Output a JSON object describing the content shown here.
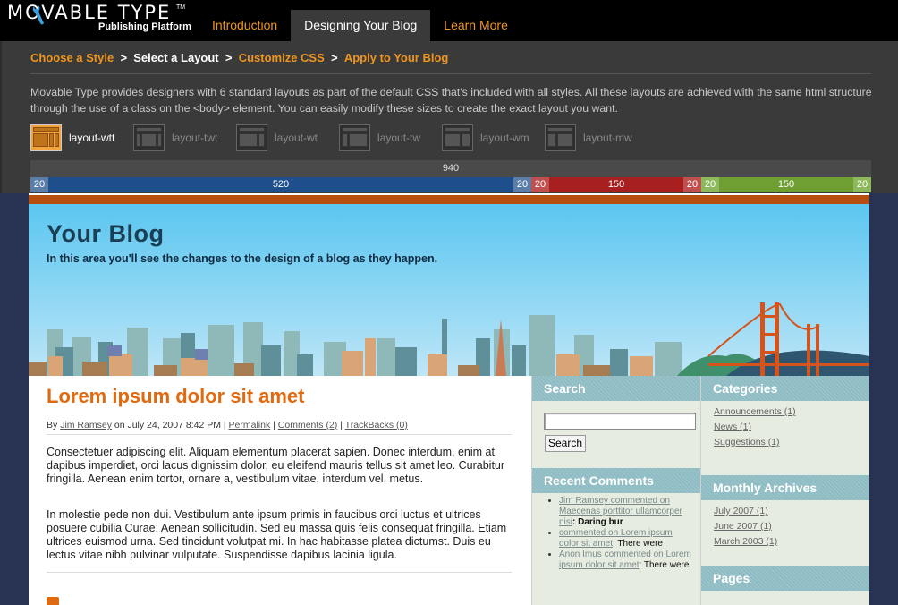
{
  "logo": {
    "word": "MOVABLE TYPE",
    "tm": "TM",
    "sub": "Publishing Platform"
  },
  "tabs": [
    "Introduction",
    "Designing Your Blog",
    "Learn More"
  ],
  "breadcrumbs": [
    "Choose a Style",
    "Select a Layout",
    "Customize CSS",
    "Apply to Your Blog"
  ],
  "breadcrumb_sep": ">",
  "description": "Movable Type provides designers with 6 standard layouts as part of the default CSS that's included with all styles. All these layouts are achieved with the same html structure through the use of a class on the <body> element. You can easily modify these sizes to create the exact layout you want.",
  "layouts": [
    "layout-wtt",
    "layout-twt",
    "layout-wt",
    "layout-tw",
    "layout-wm",
    "layout-mw"
  ],
  "selected_layout": "layout-wtt",
  "ruler": {
    "total": "940",
    "segments": [
      "20",
      "520",
      "20",
      "20",
      "150",
      "20",
      "20",
      "150",
      "20"
    ]
  },
  "colors": {
    "accent": "#f0951e",
    "blue": "#1e4f8c",
    "red": "#a81f1f",
    "green": "#6f9e33",
    "title": "#e06a10"
  },
  "blog": {
    "title": "Your Blog",
    "description": "In this area you'll see the changes to the design of a blog as they happen."
  },
  "post": {
    "title": "Lorem ipsum dolor sit amet",
    "by": "By",
    "author": "Jim Ramsey",
    "date": "on July 24, 2007 8:42 PM |",
    "permalink": "Permalink",
    "comments": "Comments (2)",
    "trackbacks": "TrackBacks (0)",
    "para1": "Consectetuer adipiscing elit. Aliquam elementum placerat sapien. Donec interdum, enim at dapibus imperdiet, orci lacus dignissim dolor, eu eleifend mauris tellus sit amet leo. Curabitur fringilla. Aenean enim tortor, ornare a, vestibulum vitae, interdum vel, metus.",
    "para2": "In molestie pede non dui. Vestibulum ante ipsum primis in faucibus orci luctus et ultrices posuere cubilia Curae; Aenean sollicitudin. Sed eu massa quis felis consequat fringilla. Etiam ultrices euismod urna. Sed tincidunt volutpat mi. In hac habitasse platea dictumst. Duis eu lectus vitae nibh pulvinar vulputate. Suspendisse dapibus lacinia ligula."
  },
  "sidebar_mid": {
    "search_title": "Search",
    "search_button": "Search",
    "recent_title": "Recent Comments",
    "recent": [
      {
        "link": "Jim Ramsey commented on Maecenas porttitor ullamcorper nisi",
        "tail": ": Daring bur"
      },
      {
        "link": "commented on Lorem ipsum dolor sit amet",
        "tail": ": There were"
      },
      {
        "link": "Anon Imus commented on Lorem ipsum dolor sit amet",
        "tail": ": There were"
      }
    ]
  },
  "sidebar_right": {
    "categories_title": "Categories",
    "categories": [
      "Announcements (1)",
      "News (1)",
      "Suggestions (1)"
    ],
    "archives_title": "Monthly Archives",
    "archives": [
      "July 2007 (1)",
      "June 2007 (1)",
      "March 2003 (1)"
    ],
    "pages_title": "Pages"
  }
}
